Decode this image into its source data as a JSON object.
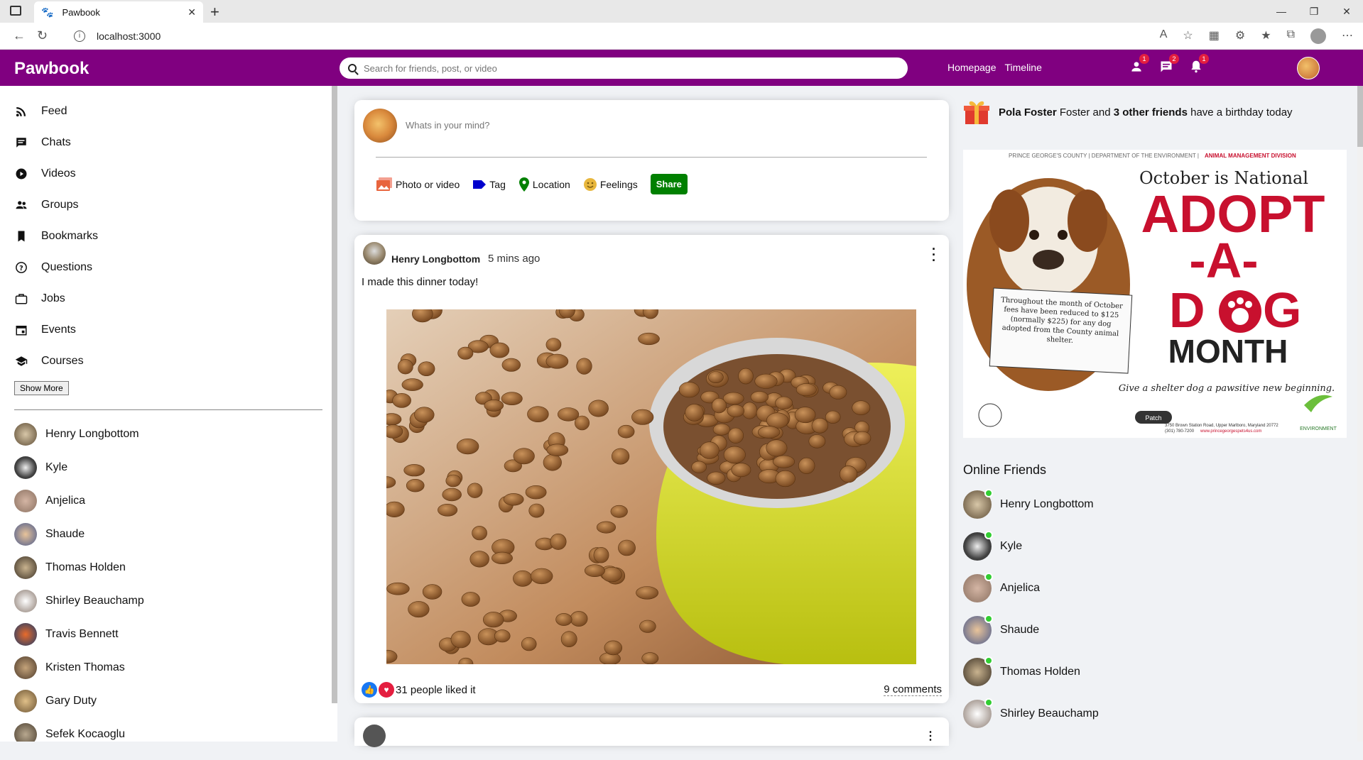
{
  "browser": {
    "tab_title": "Pawbook",
    "url": "localhost:3000"
  },
  "app": {
    "logo": "Pawbook",
    "search_placeholder": "Search for friends, post, or video",
    "nav_links": [
      "Homepage",
      "Timeline"
    ],
    "badges": {
      "friends": "1",
      "messages": "2",
      "notifications": "1"
    }
  },
  "sidebar": {
    "items": [
      {
        "label": "Feed",
        "icon": "rss-icon"
      },
      {
        "label": "Chats",
        "icon": "chat-icon"
      },
      {
        "label": "Videos",
        "icon": "play-icon"
      },
      {
        "label": "Groups",
        "icon": "group-icon"
      },
      {
        "label": "Bookmarks",
        "icon": "bookmark-icon"
      },
      {
        "label": "Questions",
        "icon": "help-icon"
      },
      {
        "label": "Jobs",
        "icon": "briefcase-icon"
      },
      {
        "label": "Events",
        "icon": "calendar-icon"
      },
      {
        "label": "Courses",
        "icon": "school-icon"
      }
    ],
    "show_more": "Show More",
    "friends": [
      "Henry Longbottom",
      "Kyle",
      "Anjelica",
      "Shaude",
      "Thomas Holden",
      "Shirley Beauchamp",
      "Travis Bennett",
      "Kristen Thomas",
      "Gary Duty",
      "Sefek Kocaoglu"
    ]
  },
  "share": {
    "placeholder": "Whats in your mind?",
    "options": [
      "Photo or video",
      "Tag",
      "Location",
      "Feelings"
    ],
    "share_label": "Share"
  },
  "post": {
    "author": "Henry Longbottom",
    "time": "5 mins ago",
    "text": "I made this dinner today!",
    "likes": "31 people liked it",
    "comments": "9 comments"
  },
  "rightbar": {
    "birthday_name": "Pola Foster",
    "birthday_mid": "Foster and",
    "birthday_friends": "3 other friends",
    "birthday_tail": "have a birthday today",
    "ad": {
      "header_left": "PRINCE GEORGE'S COUNTY | DEPARTMENT OF THE ENVIRONMENT |",
      "header_right": "ANIMAL MANAGEMENT DIVISION",
      "line1": "October is National",
      "adopt": "ADOPT",
      "a": "-A-",
      "dog_d": "D",
      "dog_g": "G",
      "month": "MONTH",
      "note": "Throughout the month of October fees have been reduced to $125 (normally $225) for any dog adopted from the County animal shelter.",
      "tagline": "Give a shelter dog a pawsitive new beginning.",
      "address": "3750 Brown Station Road, Upper Marlboro, Maryland 20772",
      "phone": "(301) 780-7200",
      "site": "www.princegeorgespets4us.com",
      "patch": "Patch",
      "env": "ENVIRONMENT"
    },
    "online_title": "Online Friends",
    "online": [
      "Henry Longbottom",
      "Kyle",
      "Anjelica",
      "Shaude",
      "Thomas Holden",
      "Shirley Beauchamp"
    ]
  }
}
